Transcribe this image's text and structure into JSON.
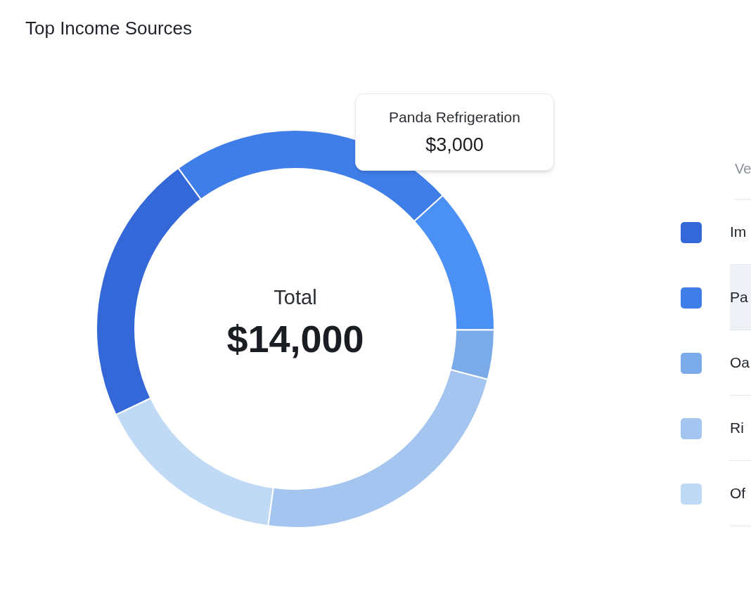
{
  "title": "Top Income Sources",
  "chart": {
    "center_label": "Total",
    "center_value": "$14,000",
    "slices": [
      {
        "color": "#3468d8"
      },
      {
        "color": "#3f7de8"
      },
      {
        "color": "#4a90f5"
      },
      {
        "color": "#7aaae8"
      },
      {
        "color": "#a3c5f0"
      },
      {
        "color": "#c0d9f5"
      }
    ],
    "chart_data": {
      "type": "donut",
      "values": [
        22.1,
        23.3,
        11.8,
        4.0,
        23.1,
        15.7
      ]
    },
    "tooltip": {
      "label": "Panda Refrigeration",
      "value": "$3,000"
    }
  },
  "legend": {
    "header": "Ve",
    "items": [
      {
        "label": "Im",
        "color": "#3468d8",
        "selected": false
      },
      {
        "label": "Pa",
        "color": "#3f7de8",
        "selected": true
      },
      {
        "label": "Oa",
        "color": "#7aaae8",
        "selected": false
      },
      {
        "label": "Ri",
        "color": "#a3c5f0",
        "selected": false
      },
      {
        "label": "Of",
        "color": "#c0d9f5",
        "selected": false
      }
    ]
  }
}
